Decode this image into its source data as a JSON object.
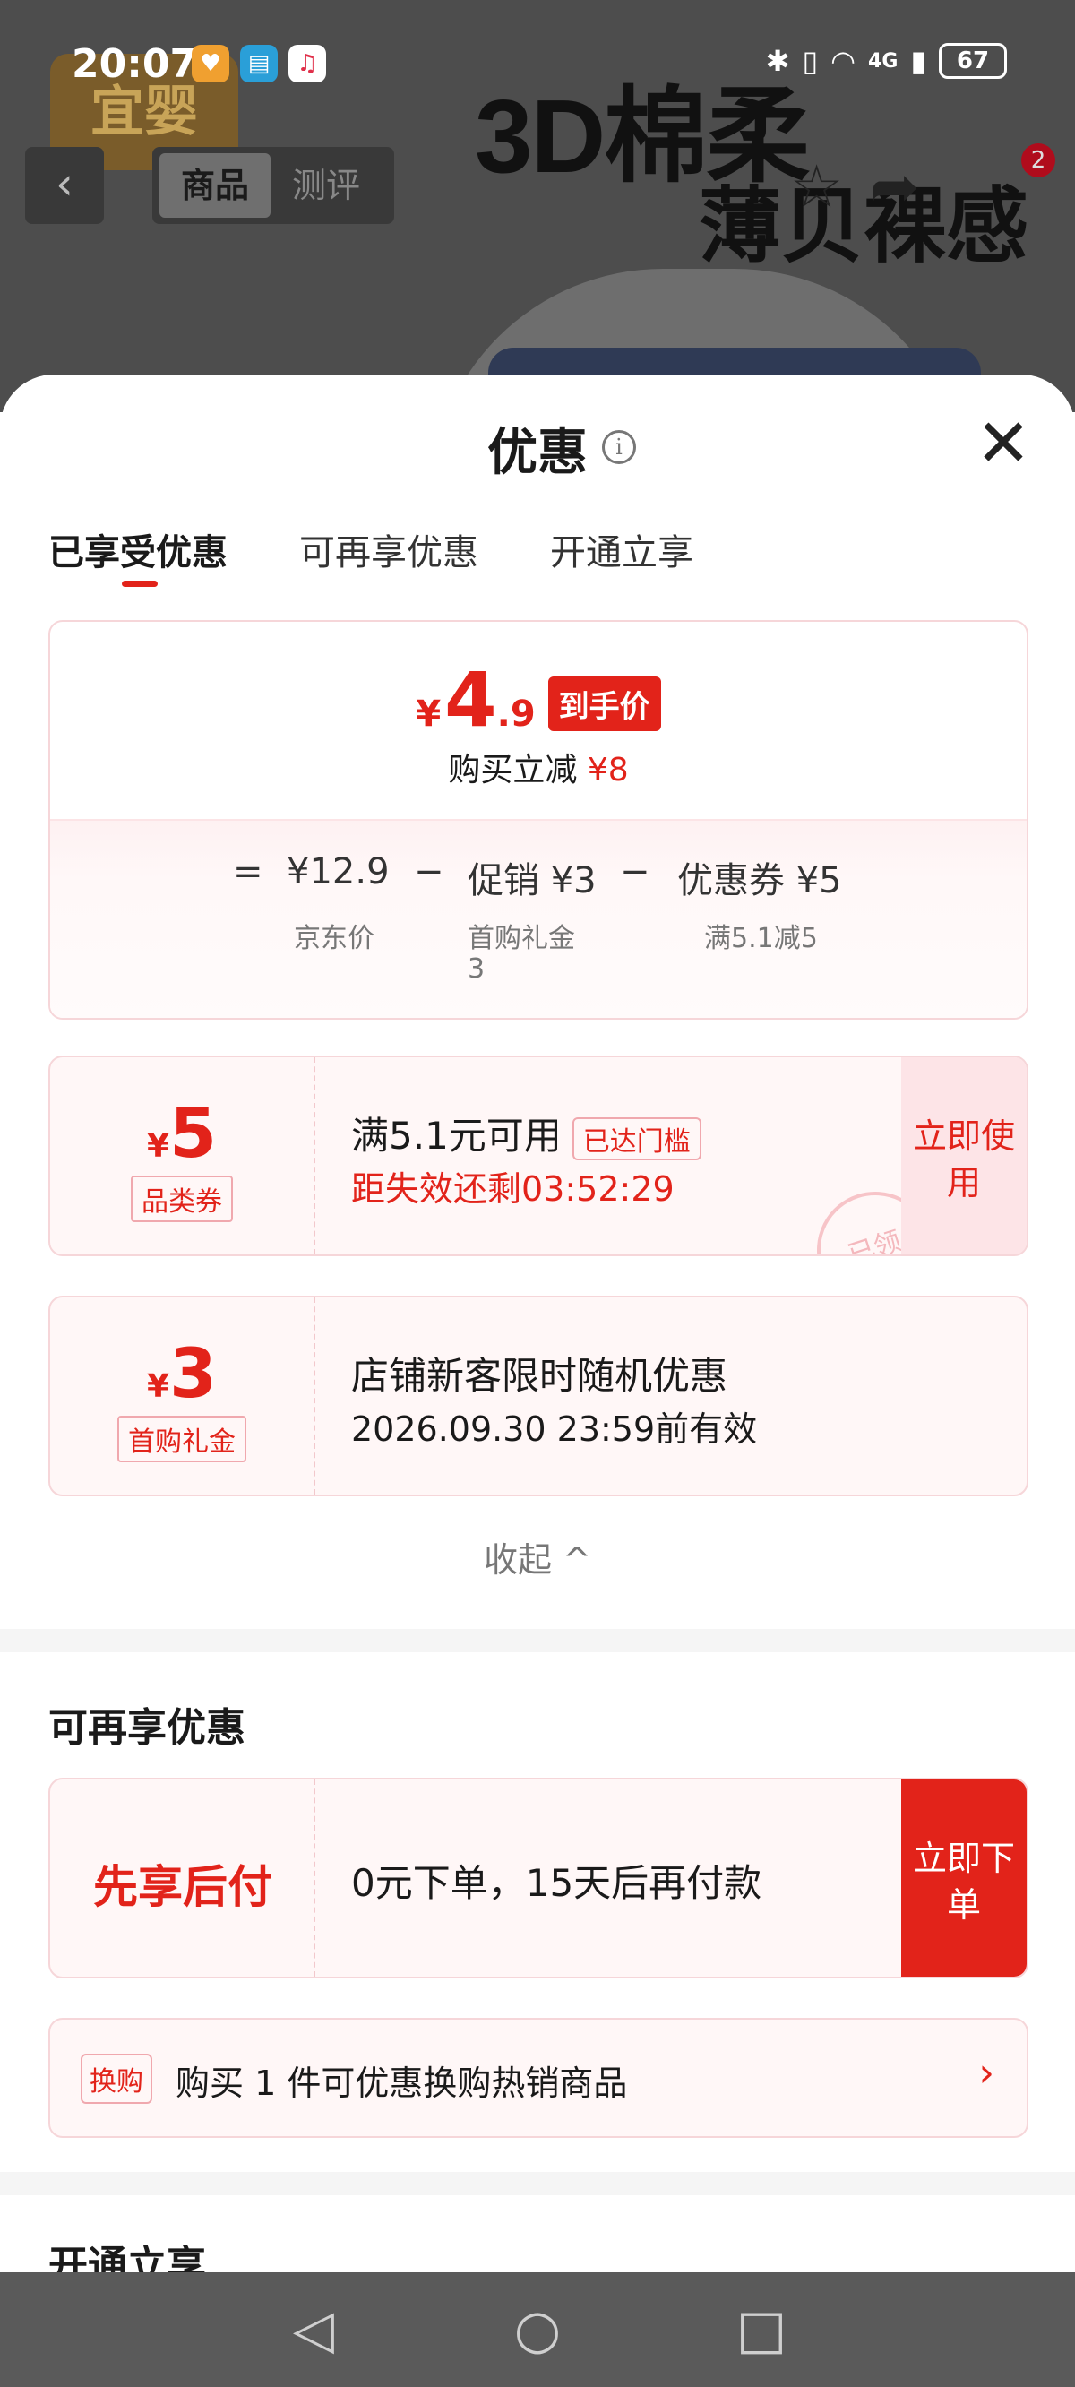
{
  "status_bar": {
    "time": "20:07",
    "network": "4G",
    "battery": "67"
  },
  "background": {
    "logo_text": "宜婴",
    "promo_line1": "3D棉柔",
    "promo_line2": "薄贝裸感"
  },
  "top_nav": {
    "back_icon": "‹",
    "tabs": [
      {
        "label": "商品"
      },
      {
        "label": "测评"
      }
    ],
    "cart_badge": "2"
  },
  "sheet": {
    "title": "优惠",
    "close_icon": "✕",
    "tabs": [
      {
        "label": "已享受优惠"
      },
      {
        "label": "可再享优惠"
      },
      {
        "label": "开通立享"
      }
    ],
    "price_card": {
      "currency": "¥",
      "price_int": "4",
      "price_dec": ".9",
      "price_tag": "到手价",
      "reduce_label": "购买立减",
      "reduce_amount": "¥8",
      "calc": {
        "eq": "=",
        "base": "¥12.9",
        "minus1": "−",
        "promo": "促销 ¥3",
        "minus2": "−",
        "coupon": "优惠券 ¥5",
        "base_label": "京东价",
        "promo_label": "首购礼金",
        "promo_value": "3",
        "coupon_label": "满5.1减5"
      }
    },
    "coupons": [
      {
        "currency": "¥",
        "amount": "5",
        "type": "品类券",
        "main": "满5.1元可用",
        "chip": "已达门槛",
        "sub": "距失效还剩03:52:29",
        "action": "立即使用",
        "stamp": "已领"
      },
      {
        "currency": "¥",
        "amount": "3",
        "type": "首购礼金",
        "main": "店铺新客限时随机优惠",
        "sub": "2026.09.30 23:59前有效"
      }
    ],
    "collapse_label": "收起 ^",
    "more_section": {
      "title": "可再享优惠",
      "bnpl": {
        "label": "先享后付",
        "desc": "0元下单，15天后再付款",
        "action": "立即下单"
      },
      "exchange": {
        "tag": "换购",
        "text": "购买 1 件可优惠换购热销商品",
        "arrow": "›"
      }
    },
    "open_section_title": "开通立享"
  },
  "nav_bar": {
    "back": "◁",
    "home": "○",
    "recent": "□"
  },
  "colors": {
    "accent": "#e2231a",
    "coupon_bg": "#fff7f7",
    "border": "#f6d6d9"
  }
}
